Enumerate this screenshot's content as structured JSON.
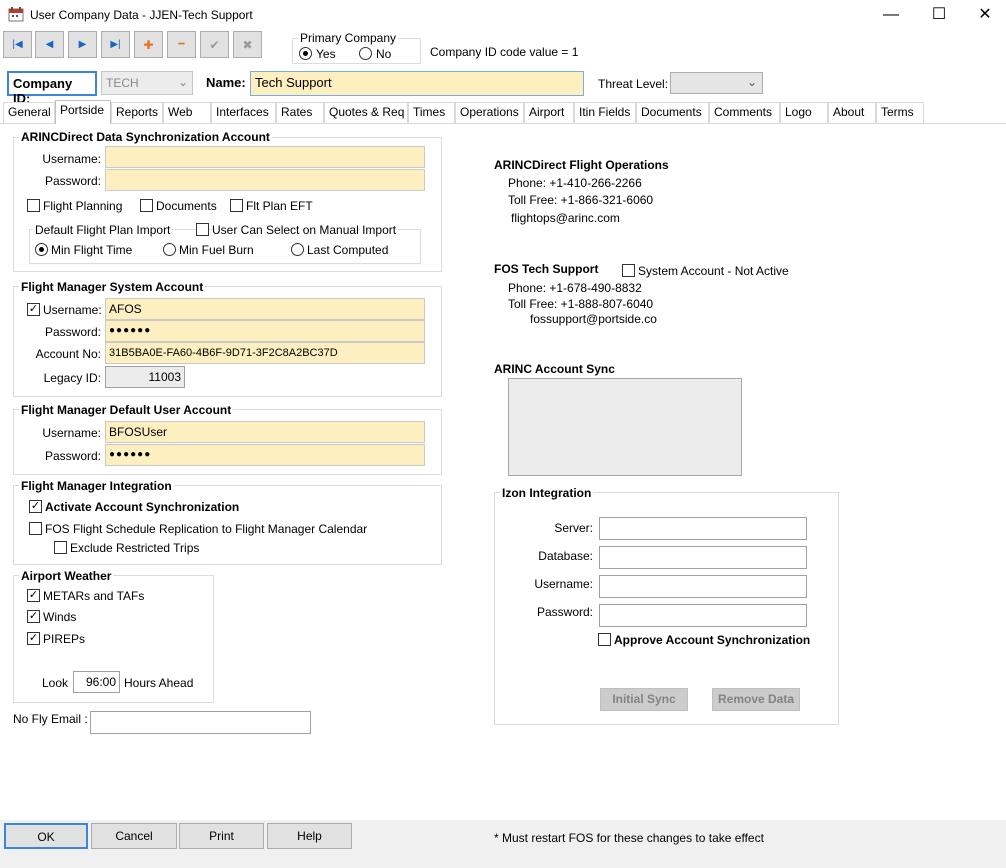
{
  "window": {
    "title": "User Company Data - JJEN-Tech Support",
    "minimize_glyph": "—",
    "maximize_glyph": "☐",
    "close_glyph": "✕"
  },
  "toolbar": {
    "buttons": [
      {
        "name": "first-record",
        "glyph": "|◀"
      },
      {
        "name": "prev-record",
        "glyph": "◀"
      },
      {
        "name": "next-record",
        "glyph": "▶"
      },
      {
        "name": "last-record",
        "glyph": "▶|"
      },
      {
        "name": "add-record",
        "glyph": "✚"
      },
      {
        "name": "delete-record",
        "glyph": "━"
      },
      {
        "name": "save-record",
        "glyph": "✔"
      },
      {
        "name": "cancel-record",
        "glyph": "✖"
      }
    ]
  },
  "primary_company": {
    "label": "Primary Company",
    "yes_label": "Yes",
    "no_label": "No",
    "selected": "Yes"
  },
  "company_id_code_text": "Company ID code value = 1",
  "header": {
    "company_id_label": "Company ID:",
    "company_id_value": "TECH",
    "name_label": "Name:",
    "name_value": "Tech Support",
    "threat_level_label": "Threat Level:",
    "threat_level_value": ""
  },
  "tabs": [
    "General",
    "Portside",
    "Reports",
    "Web",
    "Interfaces",
    "Rates",
    "Quotes & Req",
    "Times",
    "Operations",
    "Airport",
    "Itin Fields",
    "Documents",
    "Comments",
    "Logo",
    "About",
    "Terms"
  ],
  "active_tab": "Portside",
  "arinc_sync": {
    "title": "ARINCDirect Data Synchronization Account",
    "username_label": "Username:",
    "username_value": "",
    "password_label": "Password:",
    "password_value": "",
    "flight_planning_label": "Flight Planning",
    "documents_label": "Documents",
    "flt_plan_eft_label": "Flt Plan EFT",
    "default_import_label": "Default Flight Plan Import",
    "user_can_select_label": "User Can Select on Manual Import",
    "min_flight_time_label": "Min Flight Time",
    "min_fuel_burn_label": "Min Fuel Burn",
    "last_computed_label": "Last Computed",
    "selected_import": "Min Flight Time"
  },
  "fm_system": {
    "title": "Flight Manager System Account",
    "username_label": "Username:",
    "username_checked": true,
    "username_value": "AFOS",
    "password_label": "Password:",
    "password_value": "●●●●●●",
    "account_no_label": "Account No:",
    "account_no_value": "31B5BA0E-FA60-4B6F-9D71-3F2C8A2BC37D",
    "legacy_id_label": "Legacy ID:",
    "legacy_id_value": "11003"
  },
  "fm_default": {
    "title": "Flight Manager Default User Account",
    "username_label": "Username:",
    "username_value": "BFOSUser",
    "password_label": "Password:",
    "password_value": "●●●●●●"
  },
  "fm_integration": {
    "title": "Flight Manager Integration",
    "activate_label": "Activate Account Synchronization",
    "activate_checked": true,
    "replication_label": "FOS Flight Schedule Replication to Flight Manager Calendar",
    "replication_checked": false,
    "exclude_label": "Exclude Restricted Trips",
    "exclude_checked": false
  },
  "weather": {
    "title": "Airport Weather",
    "metars_label": "METARs and TAFs",
    "winds_label": "Winds",
    "pireps_label": "PIREPs",
    "look_label": "Look",
    "look_value": "96:00",
    "hours_ahead_label": "Hours Ahead"
  },
  "no_fly": {
    "label": "No Fly Email :",
    "value": ""
  },
  "flight_ops": {
    "title": "ARINCDirect Flight Operations",
    "phone": "Phone: +1-410-266-2266",
    "toll_free": "Toll Free: +1-866-321-6060",
    "email": "flightops@arinc.com"
  },
  "fos_support": {
    "title": "FOS Tech Support",
    "system_account_label": "System Account - Not Active",
    "phone": "Phone: +1-678-490-8832",
    "toll_free": "Toll Free: +1-888-807-6040",
    "email": "fossupport@portside.co"
  },
  "arinc_account_sync": {
    "title": "ARINC Account Sync"
  },
  "izon": {
    "title": "Izon Integration",
    "server_label": "Server:",
    "server_value": "",
    "database_label": "Database:",
    "database_value": "",
    "username_label": "Username:",
    "username_value": "",
    "password_label": "Password:",
    "password_value": "",
    "approve_label": "Approve Account Synchronization",
    "initial_sync_label": "Initial Sync",
    "remove_data_label": "Remove Data"
  },
  "footer": {
    "ok_label": "OK",
    "cancel_label": "Cancel",
    "print_label": "Print",
    "help_label": "Help",
    "note": "* Must restart FOS for these changes to take effect"
  }
}
